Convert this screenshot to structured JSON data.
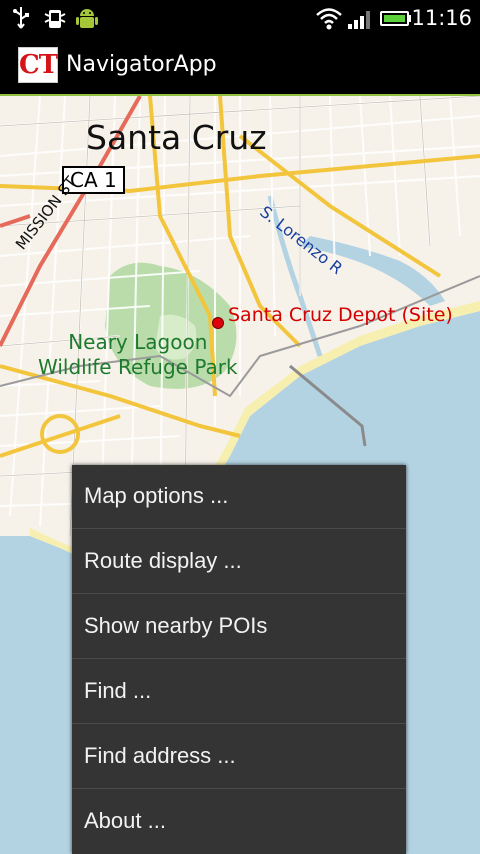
{
  "status_bar": {
    "time": "11:16",
    "left_icons": [
      "usb-icon",
      "debug-icon",
      "android-icon"
    ],
    "right_icons": [
      "wifi-icon",
      "signal-icon",
      "battery-icon"
    ]
  },
  "app": {
    "title": "NavigatorApp",
    "logo_text": "CT"
  },
  "map": {
    "city_label": "Santa Cruz",
    "highway_label": "CA 1",
    "street_label": "MISSION ST",
    "river_label": "S. Lorenzo R",
    "site_label": "Santa Cruz Depot (Site)",
    "park_label_line1": "Neary Lagoon",
    "park_label_line2": "Wildlife Refuge Park"
  },
  "menu": {
    "items": [
      {
        "label": "Map options ..."
      },
      {
        "label": "Route display ..."
      },
      {
        "label": "Show nearby POIs"
      },
      {
        "label": "Find ..."
      },
      {
        "label": "Find address ..."
      },
      {
        "label": "About ..."
      }
    ]
  },
  "colors": {
    "accent": "#8fc13e",
    "logo_red": "#d5141a",
    "menu_bg": "#343434",
    "water": "#b3d3e3",
    "park": "#b9dcaa",
    "beach": "#f7efb0",
    "major_road": "#f2c53d",
    "highway": "#e66a5a"
  }
}
